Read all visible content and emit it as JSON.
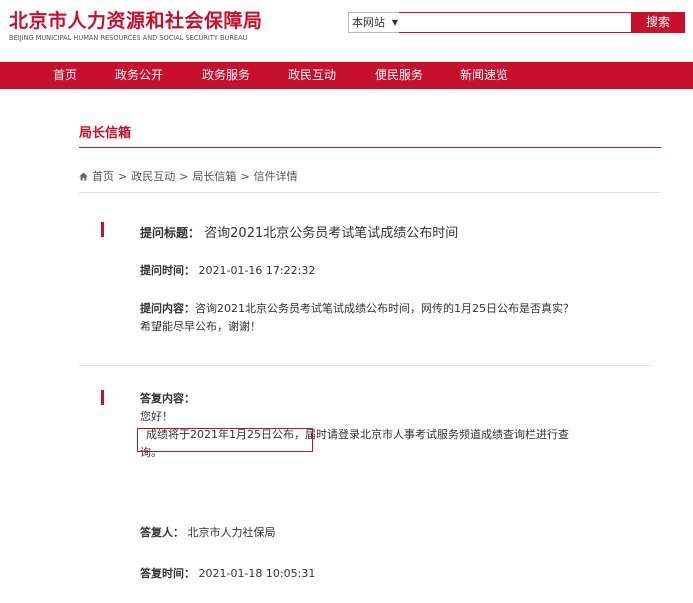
{
  "header": {
    "title": "北京市人力资源和社会保障局",
    "subtitle": "BEIJING MUNICIPAL HUMAN RESOURCES AND SOCIAL SECURITY BUREAU"
  },
  "search": {
    "scope": "本网站",
    "placeholder": "",
    "button_label": "搜索"
  },
  "nav": {
    "items": [
      {
        "label": "首页"
      },
      {
        "label": "政务公开"
      },
      {
        "label": "政务服务"
      },
      {
        "label": "政民互动"
      },
      {
        "label": "便民服务"
      },
      {
        "label": "新闻速览"
      }
    ]
  },
  "section": {
    "title": "局长信箱"
  },
  "breadcrumb": {
    "items": [
      "首页",
      "政民互动",
      "局长信箱",
      "信件详情"
    ],
    "separator": ">"
  },
  "question": {
    "title_label": "提问标题：",
    "title_value": "咨询2021北京公务员考试笔试成绩公布时间",
    "time_label": "提问时间：",
    "time_value": "2021-01-16 17:22:32",
    "content_label": "提问内容：",
    "content_line1": "咨询2021北京公务员考试笔试成绩公布时间，网传的1月25日公布是否真实？",
    "content_line2": "希望能尽早公布，谢谢！"
  },
  "answer": {
    "content_label": "答复内容：",
    "greeting": "您好！",
    "highlight": "成绩将于2021年1月25日公布",
    "rest_line1": "，届时请登录北京市人事考试服务频道成绩查询栏进行查",
    "rest_line2": "询。",
    "replier_label": "答复人：",
    "replier_value": "北京市人力社保局",
    "time_label": "答复时间：",
    "time_value": "2021-01-18 10:05:31"
  },
  "colors": {
    "brand_red": "#c8102e"
  }
}
